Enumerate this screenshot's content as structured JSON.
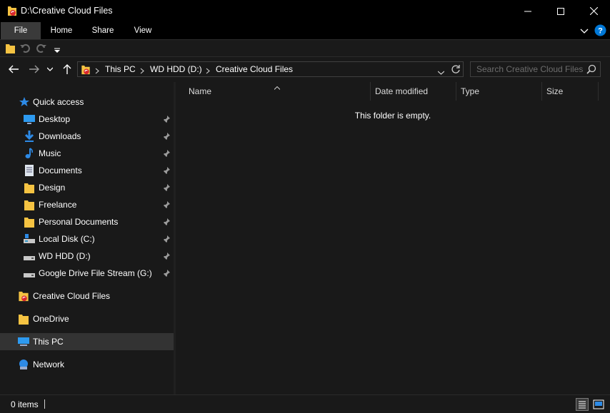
{
  "window": {
    "title": "D:\\Creative Cloud Files"
  },
  "ribbon": {
    "tabs": [
      "File",
      "Home",
      "Share",
      "View"
    ]
  },
  "address": {
    "crumbs": [
      "This PC",
      "WD HDD (D:)",
      "Creative Cloud Files"
    ]
  },
  "search": {
    "placeholder": "Search Creative Cloud Files"
  },
  "sidebar": {
    "quick_access": "Quick access",
    "items": [
      {
        "label": "Desktop",
        "icon": "desktop-icon"
      },
      {
        "label": "Downloads",
        "icon": "downloads-icon"
      },
      {
        "label": "Music",
        "icon": "music-icon"
      },
      {
        "label": "Documents",
        "icon": "documents-icon"
      },
      {
        "label": "Design",
        "icon": "folder-icon"
      },
      {
        "label": "Freelance",
        "icon": "folder-icon"
      },
      {
        "label": "Personal Documents",
        "icon": "folder-icon"
      },
      {
        "label": "Local Disk (C:)",
        "icon": "drive-icon"
      },
      {
        "label": "WD HDD (D:)",
        "icon": "drive-icon"
      },
      {
        "label": "Google Drive File Stream (G:)",
        "icon": "drive-icon"
      }
    ],
    "creative_cloud": "Creative Cloud Files",
    "onedrive": "OneDrive",
    "this_pc": "This PC",
    "network": "Network"
  },
  "columns": [
    "Name",
    "Date modified",
    "Type",
    "Size"
  ],
  "content": {
    "empty_message": "This folder is empty."
  },
  "status": {
    "items": "0 items"
  },
  "colors": {
    "background": "#191919",
    "selected": "#333333",
    "accent": "#0078d7",
    "folder": "#f5c342"
  }
}
